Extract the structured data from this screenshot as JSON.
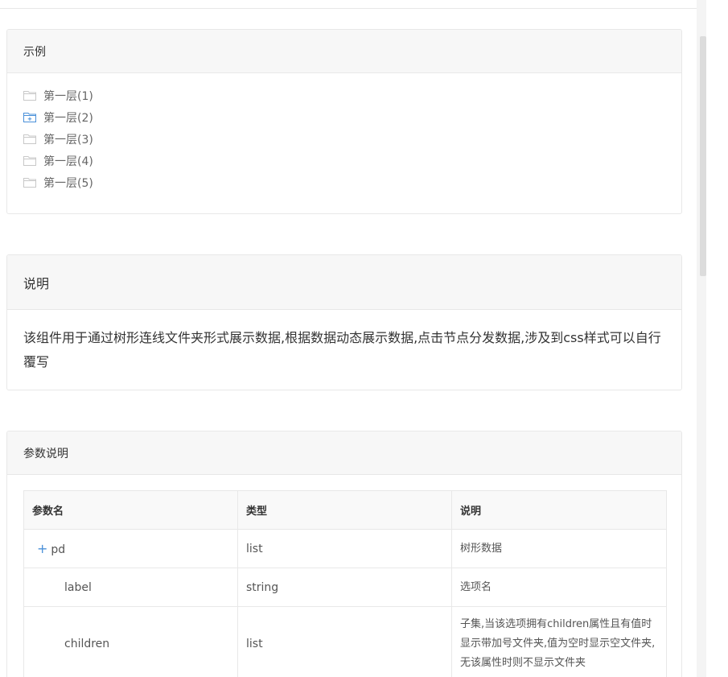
{
  "example": {
    "title": "示例",
    "tree": [
      {
        "label": "第一层(1)",
        "icon": "empty-folder-icon"
      },
      {
        "label": "第一层(2)",
        "icon": "plus-folder-icon"
      },
      {
        "label": "第一层(3)",
        "icon": "empty-folder-icon"
      },
      {
        "label": "第一层(4)",
        "icon": "empty-folder-icon"
      },
      {
        "label": "第一层(5)",
        "icon": "empty-folder-icon"
      }
    ]
  },
  "description": {
    "title": "说明",
    "text": "该组件用于通过树形连线文件夹形式展示数据,根据数据动态展示数据,点击节点分发数据,涉及到css样式可以自行覆写"
  },
  "params": {
    "title": "参数说明",
    "columns": [
      "参数名",
      "类型",
      "说明"
    ],
    "rows": [
      {
        "name": "pd",
        "type": "list",
        "desc": "树形数据",
        "expander": "+"
      },
      {
        "name": "label",
        "type": "string",
        "desc": "选项名"
      },
      {
        "name": "children",
        "type": "list",
        "desc": "子集,当该选项拥有children属性且有值时显示带加号文件夹,值为空时显示空文件夹,无该属性时则不显示文件夹"
      }
    ]
  },
  "colors": {
    "accent": "#4a90d9",
    "border": "#e8e8e8",
    "header_bg": "#f7f7f7"
  }
}
